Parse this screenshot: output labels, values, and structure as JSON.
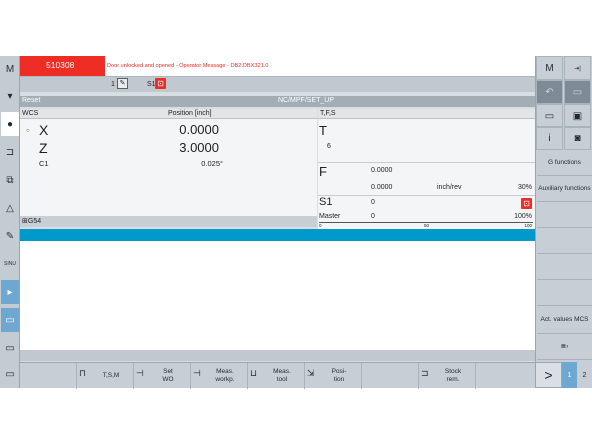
{
  "alarm": {
    "number": "510308",
    "message": "Door unlocked and opened - Operator Message - DB2.DBX321.0"
  },
  "channel": {
    "number": "1",
    "spindle_label": "S1"
  },
  "status": {
    "reset_label": "Reset",
    "program_path": "NC/MPF/SET_UP"
  },
  "wcs": {
    "header": "WCS",
    "position_header": "Position [inch]",
    "axes": [
      {
        "name": "X",
        "value": "0.0000"
      },
      {
        "name": "Z",
        "value": "3.0000"
      }
    ],
    "c1": {
      "name": "C1",
      "value": "0.025°"
    },
    "work_offset": "G54"
  },
  "tfs": {
    "header": "T,F,S",
    "tool_label": "T",
    "tool_number": "6",
    "feed_label": "F",
    "feed_value": "0.0000",
    "feed_actual": "0.0000",
    "feed_unit": "inch/rev",
    "feed_override": "30%",
    "spindle_label": "S1",
    "spindle_value": "0",
    "master_label": "Master",
    "master_value": "0",
    "master_override": "100%",
    "scale": [
      "0",
      "50",
      "100"
    ]
  },
  "left_keys": [
    "M",
    "▾",
    "●",
    "⊐",
    "⧉",
    "△",
    "✎",
    "SINU"
  ],
  "right_keys": {
    "top_left": "M",
    "top_right": "⇥|",
    "g_functions": "G functions",
    "auxiliary_functions": "Auxiliary functions",
    "act_values": "Act. values MCS",
    "info": "i"
  },
  "bottom_keys": [
    {
      "line1": "",
      "line2": ""
    },
    {
      "line1": "",
      "line2": "T,S,M"
    },
    {
      "line1": "Set",
      "line2": "WO"
    },
    {
      "line1": "Meas.",
      "line2": "workp."
    },
    {
      "line1": "Meas.",
      "line2": "tool"
    },
    {
      "line1": "Posi-",
      "line2": "tion"
    },
    {
      "line1": "",
      "line2": ""
    },
    {
      "line1": "Stock",
      "line2": "rem."
    },
    {
      "line1": "",
      "line2": ""
    }
  ],
  "pager": {
    "next": ">",
    "page1": "1",
    "page2": "2"
  }
}
